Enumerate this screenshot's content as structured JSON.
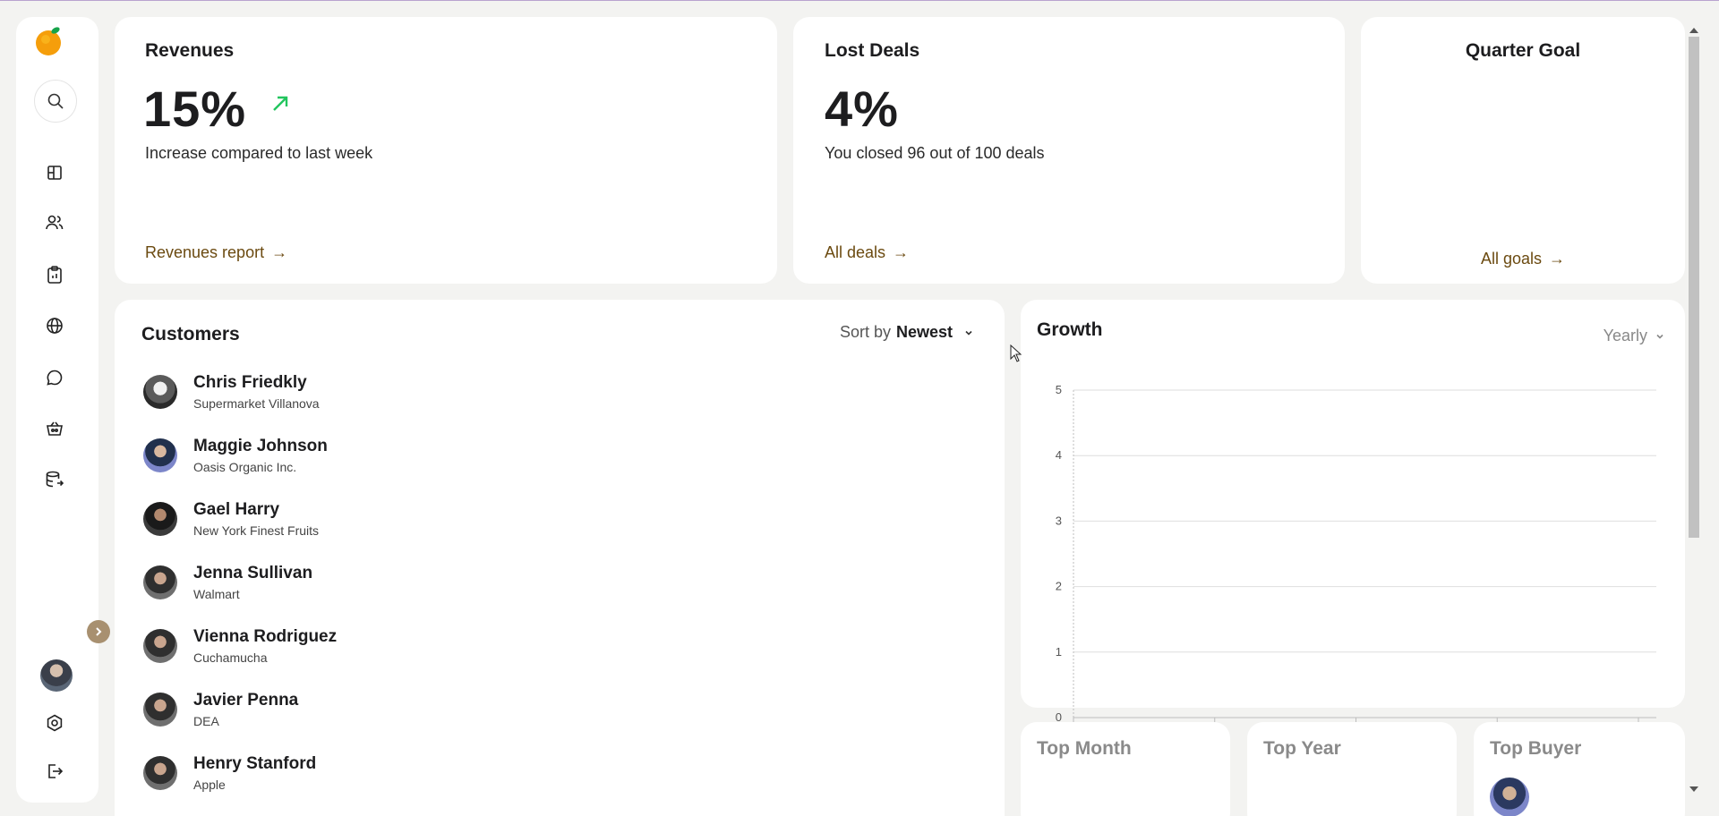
{
  "sidebar": {
    "logo": "orange-logo-icon",
    "nav_items": [
      "dashboard-icon",
      "users-icon",
      "clipboard-icon",
      "globe-icon",
      "chat-icon",
      "basket-icon",
      "database-icon"
    ],
    "bottom_items": [
      "settings-icon",
      "logout-icon"
    ]
  },
  "revenues": {
    "title": "Revenues",
    "value": "15%",
    "trend": "up",
    "description": "Increase compared to last week",
    "link_label": "Revenues report"
  },
  "lost_deals": {
    "title": "Lost Deals",
    "value": "4%",
    "description": "You closed 96 out of 100 deals",
    "link_label": "All deals"
  },
  "quarter_goal": {
    "title": "Quarter Goal",
    "link_label": "All goals"
  },
  "customers": {
    "title": "Customers",
    "sort_prefix": "Sort by",
    "sort_value": "Newest",
    "items": [
      {
        "name": "Chris Friedkly",
        "company": "Supermarket Villanova"
      },
      {
        "name": "Maggie Johnson",
        "company": "Oasis Organic Inc."
      },
      {
        "name": "Gael Harry",
        "company": "New York Finest Fruits"
      },
      {
        "name": "Jenna Sullivan",
        "company": "Walmart"
      },
      {
        "name": "Vienna Rodriguez",
        "company": "Cuchamucha"
      },
      {
        "name": "Javier Penna",
        "company": "DEA"
      },
      {
        "name": "Henry Stanford",
        "company": "Apple"
      }
    ]
  },
  "growth": {
    "title": "Growth",
    "period": "Yearly"
  },
  "chart_data": {
    "type": "line",
    "title": "",
    "y_ticks": [
      "0",
      "1",
      "2",
      "3",
      "4",
      "5"
    ],
    "ylim": [
      0,
      5
    ],
    "series": [],
    "grid": true
  },
  "top_month": {
    "title": "Top Month"
  },
  "top_year": {
    "title": "Top Year"
  },
  "top_buyer": {
    "title": "Top Buyer"
  },
  "colors": {
    "accent_link": "#6b4a10",
    "trend_up": "#22c55e",
    "background": "#f3f3f1"
  }
}
